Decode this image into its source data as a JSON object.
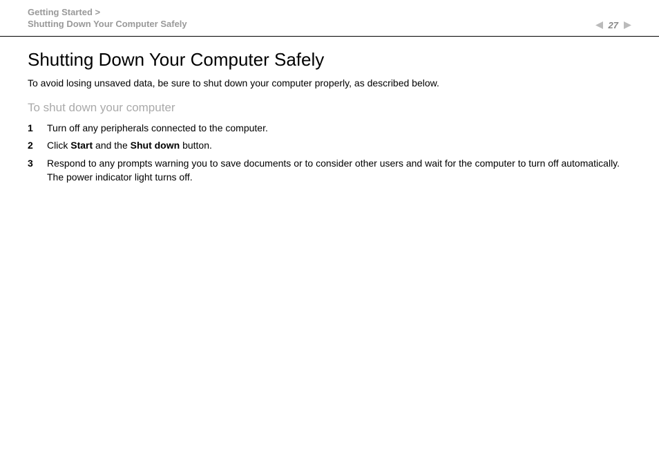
{
  "header": {
    "breadcrumb_line1": "Getting Started >",
    "breadcrumb_line2": "Shutting Down Your Computer Safely",
    "page_number": "27"
  },
  "content": {
    "title": "Shutting Down Your Computer Safely",
    "intro": "To avoid losing unsaved data, be sure to shut down your computer properly, as described below.",
    "subtitle": "To shut down your computer",
    "steps": [
      {
        "num": "1",
        "text_before": "Turn off any peripherals connected to the computer.",
        "bold1": "",
        "text_mid": "",
        "bold2": "",
        "text_after": ""
      },
      {
        "num": "2",
        "text_before": "Click ",
        "bold1": "Start",
        "text_mid": " and the ",
        "bold2": "Shut down",
        "text_after": " button."
      },
      {
        "num": "3",
        "text_before": "Respond to any prompts warning you to save documents or to consider other users and wait for the computer to turn off automatically.",
        "bold1": "",
        "text_mid": "",
        "bold2": "",
        "text_after": "",
        "line2": "The power indicator light turns off."
      }
    ]
  }
}
